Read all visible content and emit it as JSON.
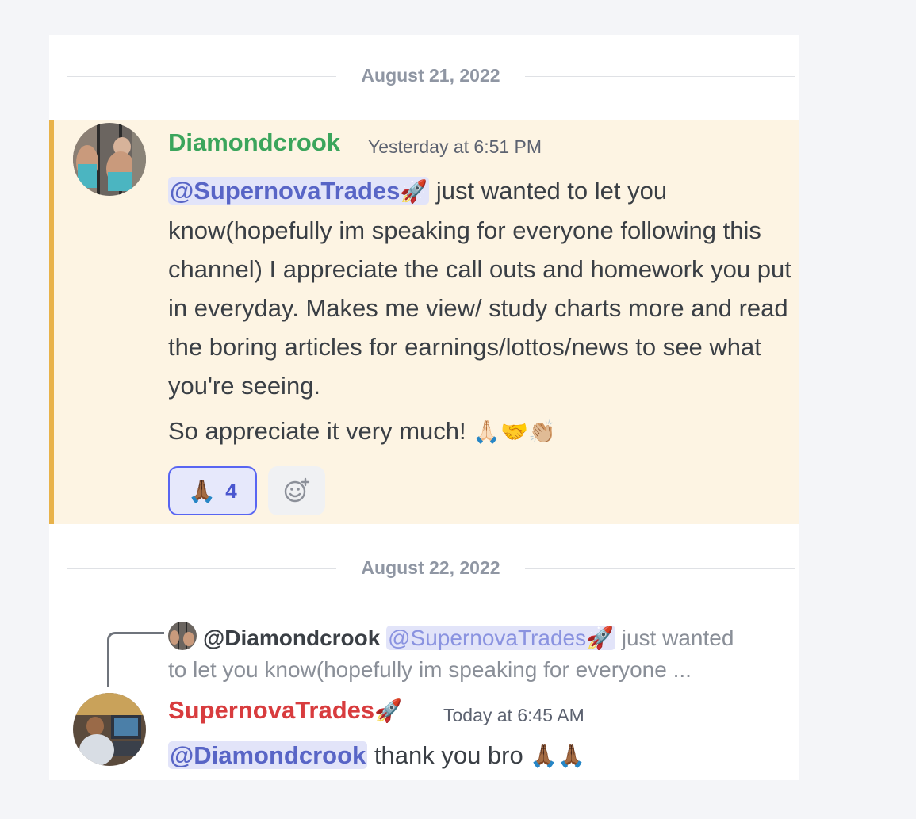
{
  "dates": {
    "first": "August 21, 2022",
    "second": "August 22, 2022"
  },
  "message1": {
    "username": "Diamondcrook",
    "timestamp": "Yesterday at 6:51 PM",
    "mention": "@SupernovaTrades",
    "mention_emoji": "🚀",
    "body": " just wanted to let you know(hopefully im speaking for everyone following this channel) I appreciate the call outs and homework you put in everyday. Makes me view/ study charts more and read the boring articles for earnings/lottos/news to see what you're seeing.",
    "body2": "So appreciate it very much! ",
    "body2_emojis": "🙏🏻🤝👏🏼",
    "reaction": {
      "emoji": "🙏🏾",
      "count": "4"
    },
    "username_color": "#3ba55c",
    "highlight_color": "#fdf4e3",
    "highlight_border": "#e8b24a"
  },
  "reply": {
    "ref_user": "@Diamondcrook",
    "ref_mention": "@SupernovaTrades",
    "ref_mention_emoji": "🚀",
    "ref_text1": " just wanted",
    "ref_text2": "to let you know(hopefully im speaking for everyone ..."
  },
  "message2": {
    "username": "SupernovaTrades",
    "username_emoji": "🚀",
    "timestamp": "Today at 6:45 AM",
    "mention": "@Diamondcrook",
    "body": " thank you bro ",
    "body_emojis": "🙏🏾🙏🏾",
    "username_color": "#d83c3e"
  },
  "icons": {
    "add_reaction": "add-reaction-icon"
  }
}
